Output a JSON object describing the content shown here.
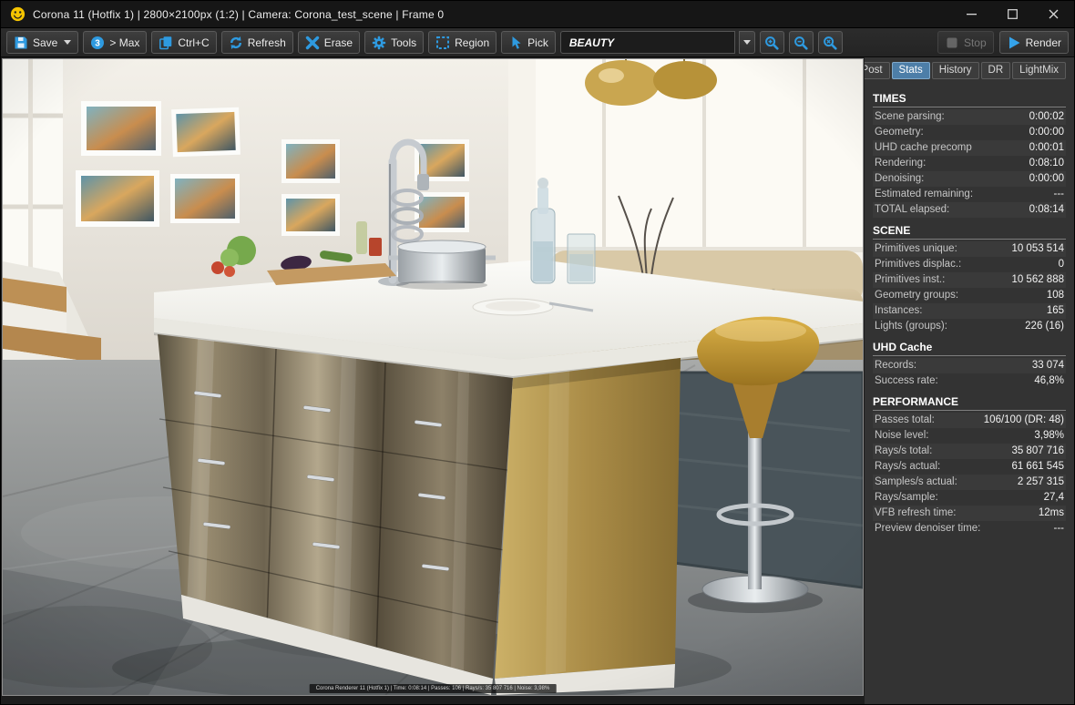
{
  "titlebar": {
    "title": "Corona 11 (Hotfix 1) | 2800×2100px (1:2) | Camera: Corona_test_scene | Frame 0"
  },
  "toolbar": {
    "save_label": "Save",
    "max_label": "> Max",
    "copy_label": "Ctrl+C",
    "refresh_label": "Refresh",
    "erase_label": "Erase",
    "tools_label": "Tools",
    "region_label": "Region",
    "pick_label": "Pick",
    "channel": "BEAUTY",
    "stop_label": "Stop",
    "render_label": "Render",
    "accent_color": "#2e9ae0"
  },
  "sidebar": {
    "tabs": [
      {
        "label": "Post",
        "active": false
      },
      {
        "label": "Stats",
        "active": true
      },
      {
        "label": "History",
        "active": false
      },
      {
        "label": "DR",
        "active": false
      },
      {
        "label": "LightMix",
        "active": false
      }
    ]
  },
  "stats": {
    "times": {
      "title": "TIMES",
      "rows": [
        {
          "label": "Scene parsing:",
          "value": "0:00:02"
        },
        {
          "label": "Geometry:",
          "value": "0:00:00"
        },
        {
          "label": "UHD cache precomp",
          "value": "0:00:01"
        },
        {
          "label": "Rendering:",
          "value": "0:08:10"
        },
        {
          "label": "Denoising:",
          "value": "0:00:00"
        },
        {
          "label": "Estimated remaining:",
          "value": "---"
        },
        {
          "label": "TOTAL elapsed:",
          "value": "0:08:14"
        }
      ]
    },
    "scene": {
      "title": "SCENE",
      "rows": [
        {
          "label": "Primitives unique:",
          "value": "10 053 514"
        },
        {
          "label": "Primitives displac.:",
          "value": "0"
        },
        {
          "label": "Primitives inst.:",
          "value": "10 562 888"
        },
        {
          "label": "Geometry groups:",
          "value": "108"
        },
        {
          "label": "Instances:",
          "value": "165"
        },
        {
          "label": "Lights (groups):",
          "value": "226 (16)"
        }
      ]
    },
    "uhd": {
      "title": "UHD Cache",
      "rows": [
        {
          "label": "Records:",
          "value": "33 074"
        },
        {
          "label": "Success rate:",
          "value": "46,8%"
        }
      ]
    },
    "performance": {
      "title": "PERFORMANCE",
      "rows": [
        {
          "label": "Passes total:",
          "value": "106/100 (DR: 48)"
        },
        {
          "label": "Noise level:",
          "value": "3,98%"
        },
        {
          "label": "Rays/s total:",
          "value": "35 807 716"
        },
        {
          "label": "Rays/s actual:",
          "value": "61 661 545"
        },
        {
          "label": "Samples/s actual:",
          "value": "2 257 315"
        },
        {
          "label": "Rays/sample:",
          "value": "27,4"
        },
        {
          "label": "VFB refresh time:",
          "value": "12ms"
        },
        {
          "label": "Preview denoiser time:",
          "value": "---"
        }
      ]
    }
  },
  "viewport": {
    "stamp": "Corona Renderer 11 (Hotfix 1) | Time: 0:08:14 | Passes: 106 | Rays/s: 35 807 716 | Noise: 3,98%"
  }
}
